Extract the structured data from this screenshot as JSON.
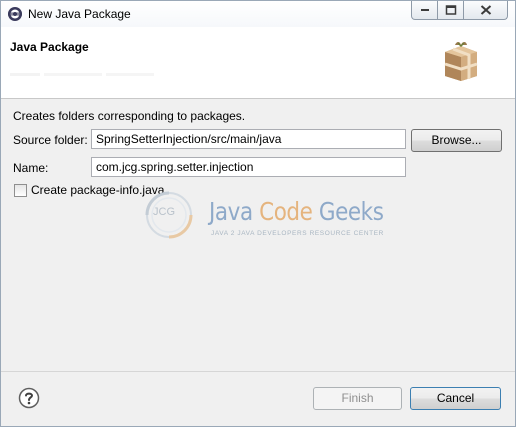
{
  "window": {
    "title": "New Java Package",
    "icons": {
      "app": "eclipse-icon",
      "minimize": "minimize-icon",
      "maximize": "maximize-icon",
      "close": "close-icon"
    }
  },
  "banner": {
    "title": "Java Package",
    "icon": "package-icon"
  },
  "form": {
    "description": "Creates folders corresponding to packages.",
    "source_folder": {
      "label": "Source folder:",
      "value": "SpringSetterInjection/src/main/java"
    },
    "browse_label": "Browse...",
    "name": {
      "label": "Name:",
      "value": "com.jcg.spring.setter.injection"
    },
    "package_info": {
      "label": "Create package-info.java",
      "checked": false
    }
  },
  "watermark": {
    "badge": "JCG",
    "java": "Java",
    "code": "Code",
    "geeks": "Geeks",
    "tagline": "JAVA 2 JAVA DEVELOPERS RESOURCE CENTER"
  },
  "footer": {
    "help_icon": "help-icon",
    "finish_label": "Finish",
    "cancel_label": "Cancel"
  },
  "colors": {
    "banner_bg": "#ffffff",
    "dialog_bg": "#f0f0f0",
    "watermark_blue": "#8ea9c9",
    "watermark_orange": "#e5b47e",
    "disabled_text": "#8f8f8f"
  }
}
